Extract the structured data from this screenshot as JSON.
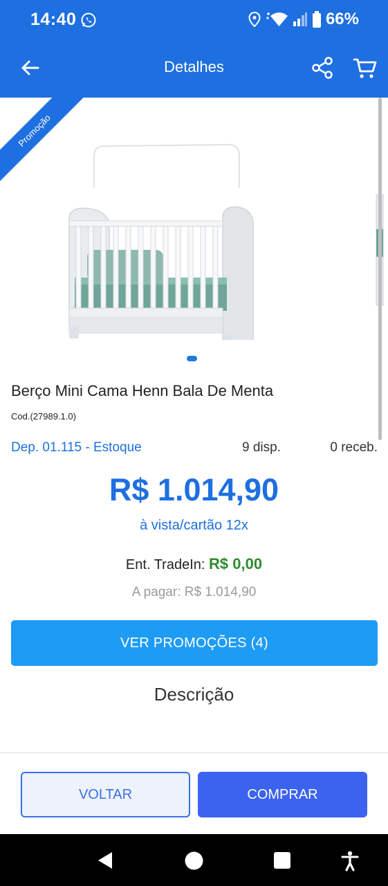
{
  "status_bar": {
    "time": "14:40",
    "battery": "66%",
    "icons": [
      "whatsapp-icon",
      "location-icon",
      "wifi-icon",
      "signal-icon",
      "battery-icon"
    ]
  },
  "app_bar": {
    "title": "Detalhes",
    "icons": [
      "back-arrow-icon",
      "share-icon",
      "cart-icon"
    ]
  },
  "carousel": {
    "ribbon": "Promoção"
  },
  "product": {
    "name": "Berço Mini Cama Henn Bala De Menta",
    "code": "Cod.(27989.1.0)",
    "stock": {
      "dep": "Dep. 01.115 - Estoque",
      "disp": "9 disp.",
      "receb": "0 receb."
    },
    "price": "R$ 1.014,90",
    "payment_terms": "à vista/cartão 12x",
    "tradein_label": "Ent. TradeIn: ",
    "tradein_value": "R$ 0,00",
    "to_pay": "A pagar: R$ 1.014,90"
  },
  "actions": {
    "promotions": "VER PROMOÇÕES (4)",
    "description_title": "Descrição",
    "back": "VOLTAR",
    "buy": "COMPRAR"
  },
  "colors": {
    "primary": "#1e6fe0",
    "promo_button": "#1e9bf5",
    "buy_button": "#3c63f0",
    "tradein_green": "#2e8b2e"
  }
}
